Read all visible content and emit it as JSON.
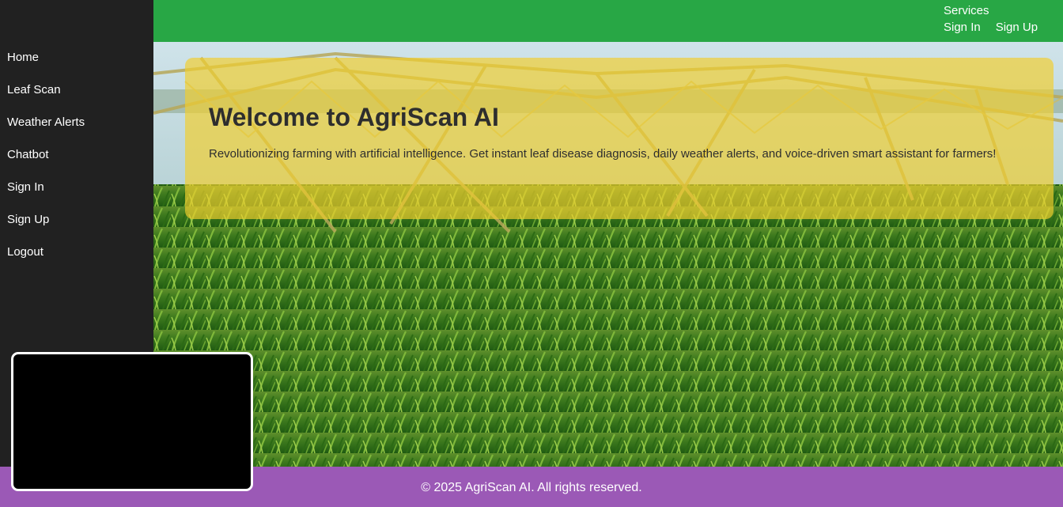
{
  "sidebar": {
    "items": [
      {
        "label": "Home"
      },
      {
        "label": "Leaf Scan"
      },
      {
        "label": "Weather Alerts"
      },
      {
        "label": "Chatbot"
      },
      {
        "label": "Sign In"
      },
      {
        "label": "Sign Up"
      },
      {
        "label": "Logout"
      }
    ]
  },
  "topbar": {
    "services": "Services",
    "sign_in": "Sign In",
    "sign_up": "Sign Up",
    "color": "#28a745"
  },
  "hero": {
    "title": "Welcome to AgriScan AI",
    "description": "Revolutionizing farming with artificial intelligence. Get instant leaf disease diagnosis, daily weather alerts, and voice-driven smart assistant for farmers!",
    "background": "corn-field-irrigation-image"
  },
  "footer": {
    "text": "© 2025 AgriScan AI. All rights reserved.",
    "color": "#9b59b6"
  },
  "colors": {
    "sidebar_bg": "#212121",
    "card_bg": "#f1ce2d"
  }
}
